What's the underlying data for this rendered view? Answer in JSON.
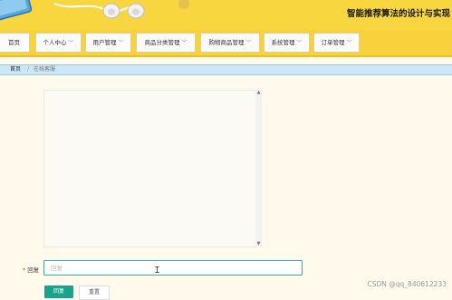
{
  "banner": {
    "title": "智能推荐算法的设计与实现"
  },
  "nav": {
    "items": [
      {
        "label": "首页",
        "has_dropdown": false
      },
      {
        "label": "个人中心",
        "has_dropdown": true
      },
      {
        "label": "用户管理",
        "has_dropdown": true
      },
      {
        "label": "商品分类管理",
        "has_dropdown": true
      },
      {
        "label": "购物商品管理",
        "has_dropdown": true
      },
      {
        "label": "系统管理",
        "has_dropdown": true
      },
      {
        "label": "订单管理",
        "has_dropdown": true
      }
    ]
  },
  "breadcrumb": {
    "home": "首页",
    "separator": "/",
    "current": "在线客服"
  },
  "form": {
    "reply_label": "回复",
    "required_mark": "*",
    "reply_placeholder": "回复",
    "reply_value": "",
    "send_label": "回复",
    "reset_label": "重置"
  },
  "watermark": "CSDN @qq_840612233",
  "colors": {
    "banner": "#f7d640",
    "nav": "#f8d23c",
    "breadcrumb_bg": "#cde7f5",
    "accent": "#19a38e",
    "input_border": "#2bb5a2"
  }
}
